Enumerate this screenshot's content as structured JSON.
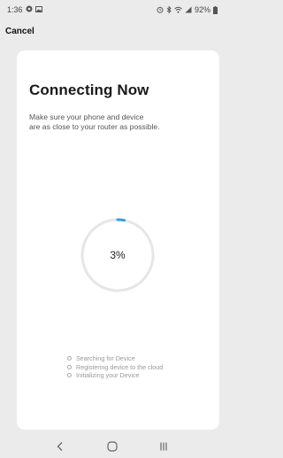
{
  "status_bar": {
    "time": "1:36",
    "battery_percent": "92%",
    "left_icons": [
      "settings-notification-icon",
      "image-notification-icon"
    ],
    "right_icons": [
      "alarm-icon",
      "bluetooth-icon",
      "wifi-icon",
      "signal-icon",
      "battery-icon"
    ]
  },
  "header": {
    "cancel_label": "Cancel"
  },
  "card": {
    "title": "Connecting Now",
    "subtitle_line1": "Make sure your phone and device",
    "subtitle_line2": "are as close to your router as possible."
  },
  "progress": {
    "value": 3,
    "label": "3%",
    "track_color": "#e6e6e6",
    "fill_color": "#3d9be0"
  },
  "steps": [
    {
      "label": "Searching for Device"
    },
    {
      "label": "Registering device to the cloud"
    },
    {
      "label": "Initializing your Device"
    }
  ],
  "nav": {
    "back_icon": "back-chevron-icon",
    "home_icon": "home-icon",
    "recents_icon": "recent-apps-icon"
  },
  "colors": {
    "background": "#ebebeb",
    "card": "#ffffff",
    "title": "#1a1a1a"
  }
}
